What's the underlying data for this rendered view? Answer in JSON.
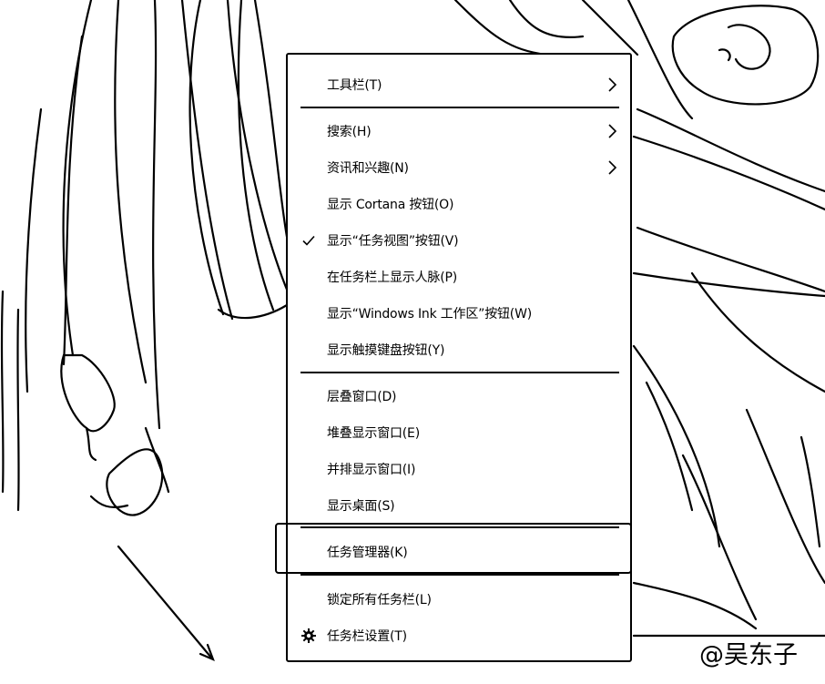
{
  "context_menu": {
    "items": [
      {
        "label": "工具栏(T)",
        "submenu": true
      },
      {
        "label": "搜索(H)",
        "submenu": true
      },
      {
        "label": "资讯和兴趣(N)",
        "submenu": true
      },
      {
        "label": "显示 Cortana 按钮(O)"
      },
      {
        "label": "显示“任务视图”按钮(V)",
        "checked": true
      },
      {
        "label": "在任务栏上显示人脉(P)"
      },
      {
        "label": "显示“Windows Ink 工作区”按钮(W)"
      },
      {
        "label": "显示触摸键盘按钮(Y)"
      },
      {
        "label": "层叠窗口(D)"
      },
      {
        "label": "堆叠显示窗口(E)"
      },
      {
        "label": "并排显示窗口(I)"
      },
      {
        "label": "显示桌面(S)"
      },
      {
        "label": "任务管理器(K)",
        "highlighted": true
      },
      {
        "label": "锁定所有任务栏(L)"
      },
      {
        "label": "任务栏设置(T)",
        "icon": "gear-icon"
      }
    ]
  },
  "watermark": {
    "text": "@吴东子"
  },
  "icons": {
    "submenu": "chevron-right-icon",
    "check": "checkmark-icon",
    "settings": "gear-icon",
    "annotation": "arrow-icon"
  },
  "colors": {
    "ink": "#000000",
    "background": "#ffffff"
  }
}
